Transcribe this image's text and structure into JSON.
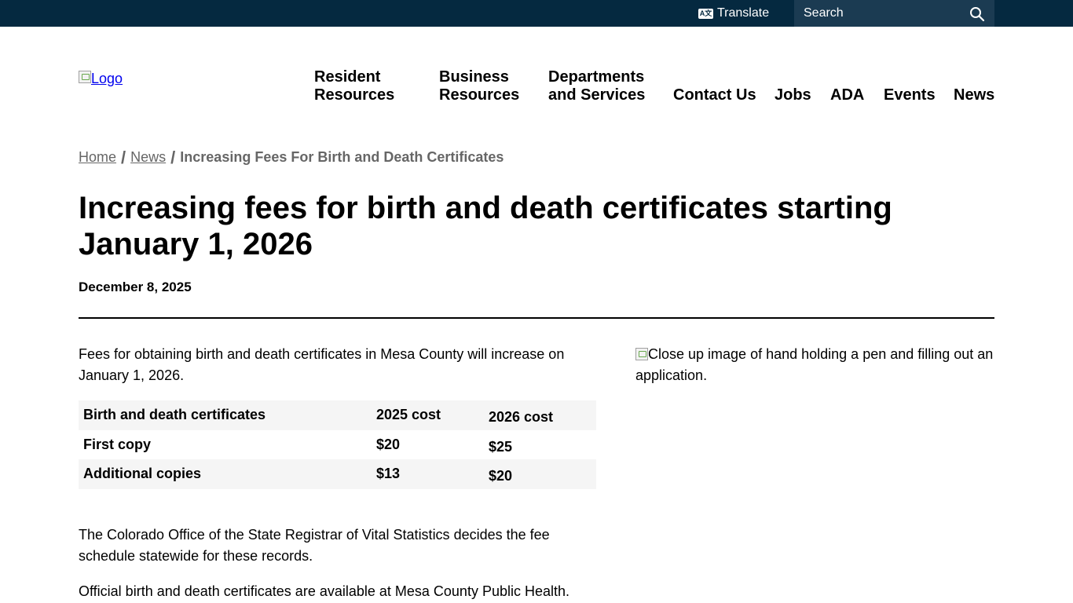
{
  "topbar": {
    "translate_label": "Translate",
    "search_placeholder": "Search"
  },
  "header": {
    "logo_alt": "Logo",
    "nav": [
      {
        "line1": "Resident",
        "line2": "Resources"
      },
      {
        "line1": "Business",
        "line2": "Resources"
      },
      {
        "line1": "Departments",
        "line2": "and Services"
      },
      {
        "label": "Contact Us"
      },
      {
        "label": "Jobs"
      },
      {
        "label": "ADA"
      },
      {
        "label": "Events"
      },
      {
        "label": "News"
      }
    ]
  },
  "breadcrumb": {
    "home": "Home",
    "separator": "/",
    "news": "News",
    "current": "Increasing Fees For Birth and Death Certificates"
  },
  "article": {
    "title": "Increasing fees for birth and death certificates starting January 1, 2026",
    "date": "December 8, 2025",
    "intro": "Fees for obtaining birth and death certificates in Mesa County will increase on January 1, 2026.",
    "table": {
      "headers": [
        "Birth and death certificates",
        "2025 cost",
        "2026 cost"
      ],
      "rows": [
        [
          "First copy",
          "$20",
          "$25"
        ],
        [
          "Additional copies",
          "$13",
          "$20"
        ]
      ]
    },
    "paragraph_2": "The Colorado Office of the State Registrar of Vital Statistics decides the fee schedule statewide for these records.",
    "paragraph_3": "Official birth and death certificates are available at Mesa County Public Health.",
    "image_alt": "Close up image of hand holding a pen and filling out an application."
  },
  "colors": {
    "topbar_bg": "#052940",
    "search_bg": "#1b3b52",
    "table_shade": "#f5f5f5"
  }
}
